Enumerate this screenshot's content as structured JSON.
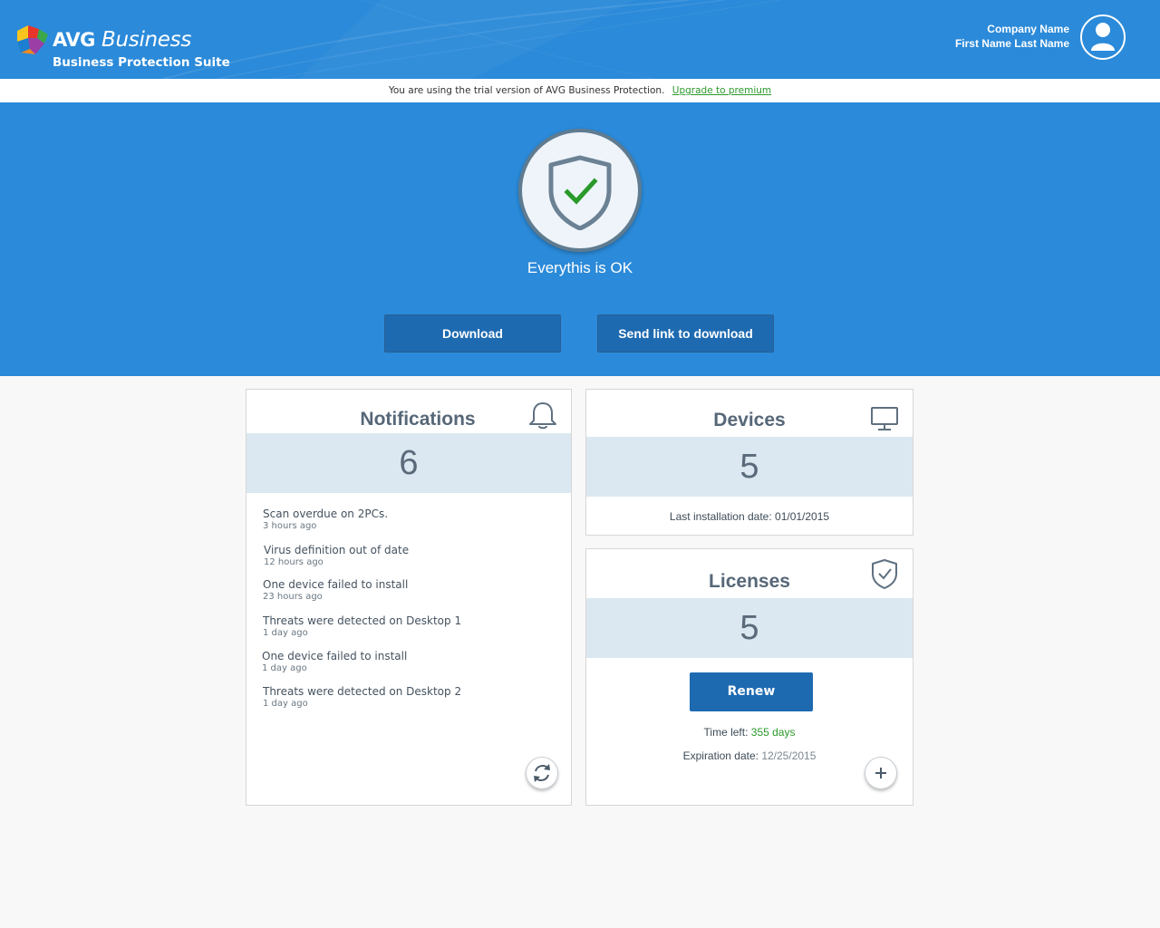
{
  "header": {
    "brand_main": "AVG",
    "brand_product": "Business",
    "brand_suite": "Business Protection Suite",
    "company_name": "Company Name",
    "user_name": "First Name Last Name"
  },
  "trial_bar": {
    "message": "You are using the trial version of AVG Business Protection.",
    "upgrade_link": "Upgrade to premium"
  },
  "status": {
    "text": "Everythis is OK"
  },
  "actions": {
    "download_label": "Download",
    "send_link_label": "Send link to download"
  },
  "notifications": {
    "title": "Notifications",
    "count": "6",
    "items": [
      {
        "title": "Scan overdue on 2PCs.",
        "time": "3 hours ago"
      },
      {
        "title": "Virus definition out of date",
        "time": "12 hours ago"
      },
      {
        "title": "One device failed to install",
        "time": "23 hours ago"
      },
      {
        "title": "Threats were detected on Desktop 1",
        "time": "1 day ago"
      },
      {
        "title": "One device failed to install",
        "time": "1 day ago"
      },
      {
        "title": "Threats were detected on Desktop 2",
        "time": "1 day ago"
      }
    ]
  },
  "devices": {
    "title": "Devices",
    "count": "5",
    "last_install_label": "Last installation date:",
    "last_install_value": "01/01/2015"
  },
  "licenses": {
    "title": "Licenses",
    "count": "5",
    "renew_label": "Renew",
    "time_left_label": "Time left:",
    "time_left_value": "355 days",
    "expiration_label": "Expiration date:",
    "expiration_value": "12/25/2015"
  },
  "colors": {
    "brand_blue": "#2b8ad9",
    "button_blue": "#1e6ab1",
    "success_green": "#2a9a2a",
    "count_panel": "#dbe8f1"
  },
  "icons": {
    "logo": "avg-logo-icon",
    "avatar": "user-avatar-icon",
    "status": "shield-check-icon",
    "notifications": "bell-icon",
    "devices": "monitor-icon",
    "licenses": "shield-check-outline-icon",
    "refresh": "refresh-icon",
    "add": "plus-icon"
  }
}
